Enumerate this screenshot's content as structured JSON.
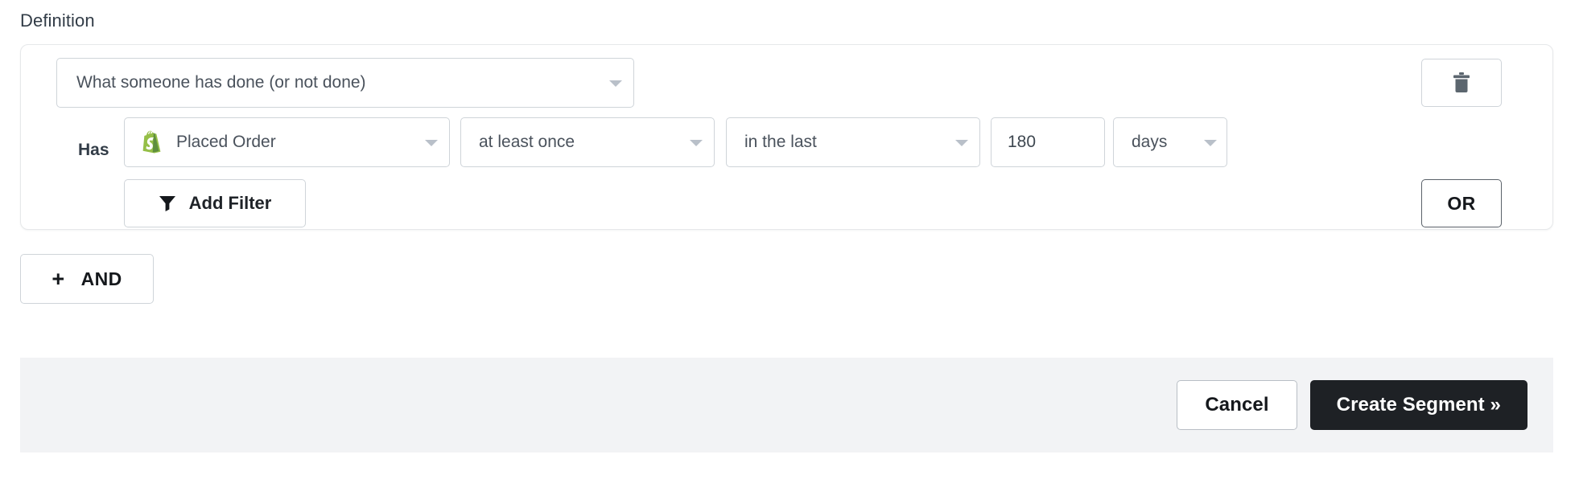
{
  "section": {
    "label": "Definition"
  },
  "definition": {
    "type_select": {
      "value": "What someone has done (or not done)",
      "icon": "chevron-down-icon"
    },
    "delete_button": {
      "icon": "trash-icon",
      "label": ""
    },
    "filter_row": {
      "prefix_label": "Has",
      "metric": {
        "value": "Placed Order",
        "icon": "shopify-icon",
        "icon_color": "#95BF47"
      },
      "frequency": {
        "value": "at least once"
      },
      "timeframe": {
        "value": "in the last"
      },
      "amount": {
        "value": "180",
        "placeholder": ""
      },
      "unit": {
        "value": "days"
      }
    },
    "add_filter_button": {
      "label": "Add Filter",
      "icon": "funnel-icon"
    },
    "or_button": {
      "label": "OR"
    }
  },
  "and_button": {
    "plus": "+",
    "label": "AND"
  },
  "footer": {
    "cancel_label": "Cancel",
    "primary_label": "Create Segment »"
  },
  "colors": {
    "primary_button": "#1e2125",
    "footer_background": "#f2f3f5",
    "border": "#cfd4d9",
    "shopify_green": "#95BF47",
    "text_dark": "#323c47"
  }
}
